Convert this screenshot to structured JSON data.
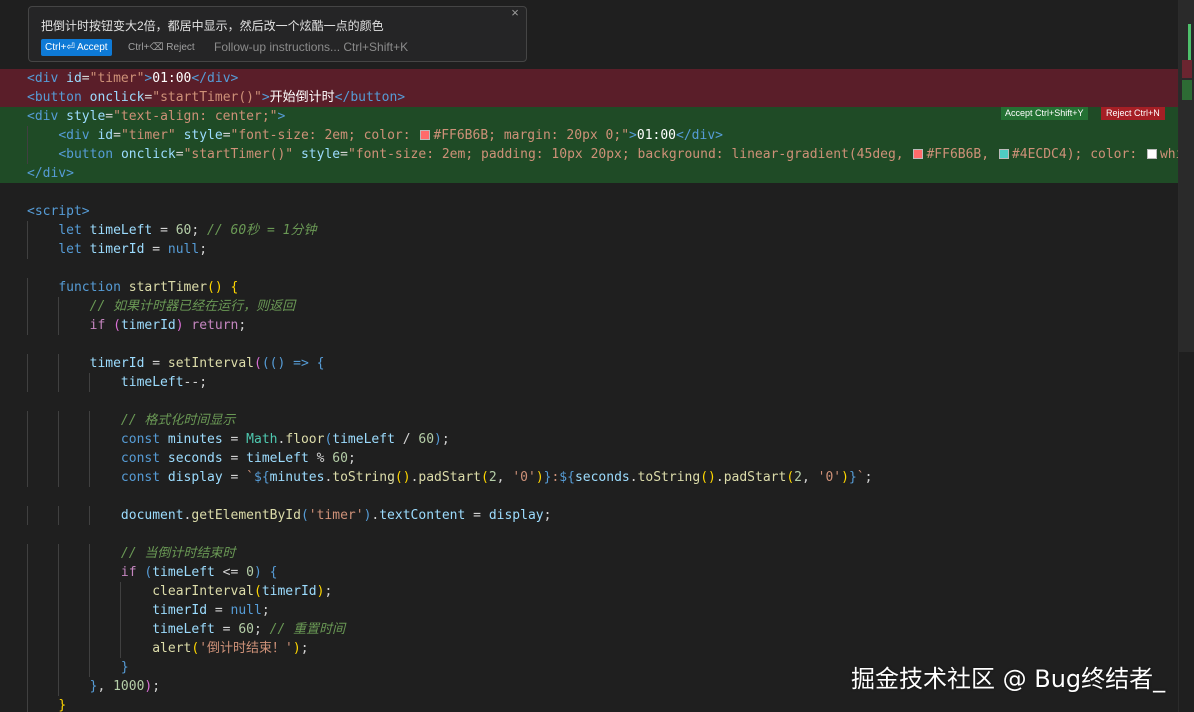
{
  "prompt": {
    "instruction": "把倒计时按钮变大2倍，都居中显示，然后改一个炫酷一点的颜色",
    "accept_label": "Ctrl+⏎ Accept",
    "reject_label": "Ctrl+⌫ Reject",
    "followup_placeholder": "Follow-up instructions... Ctrl+Shift+K",
    "close_icon": "×"
  },
  "diff_actions": {
    "accept_label": "Accept Ctrl+Shift+Y",
    "reject_label": "Reject Ctrl+N"
  },
  "colors": {
    "deleted_bg": "#5a1e29",
    "added_bg": "#1f4b26",
    "swatch_coral": "#FF6B6B",
    "swatch_teal": "#4ECDC4",
    "swatch_white": "#ffffff"
  },
  "code_lines": [
    {
      "kind": "del",
      "indent": 0,
      "tokens": [
        [
          "tag",
          "<div "
        ],
        [
          "attr",
          "id"
        ],
        [
          "op",
          "="
        ],
        [
          "str",
          "\"timer\""
        ],
        [
          "tag",
          ">"
        ],
        [
          "white",
          "01:00"
        ],
        [
          "tag",
          "</div>"
        ]
      ]
    },
    {
      "kind": "del",
      "indent": 0,
      "tokens": [
        [
          "tag",
          "<button "
        ],
        [
          "attr",
          "onclick"
        ],
        [
          "op",
          "="
        ],
        [
          "str",
          "\"startTimer()\""
        ],
        [
          "tag",
          ">"
        ],
        [
          "white",
          "开始倒计时"
        ],
        [
          "tag",
          "</button>"
        ]
      ]
    },
    {
      "kind": "add",
      "indent": 0,
      "tokens": [
        [
          "tag",
          "<div "
        ],
        [
          "attr",
          "style"
        ],
        [
          "op",
          "="
        ],
        [
          "str",
          "\"text-align: center;\""
        ],
        [
          "tag",
          ">"
        ]
      ]
    },
    {
      "kind": "add",
      "indent": 1,
      "tokens": [
        [
          "tag",
          "<div "
        ],
        [
          "attr",
          "id"
        ],
        [
          "op",
          "="
        ],
        [
          "str",
          "\"timer\""
        ],
        [
          "plain",
          " "
        ],
        [
          "attr",
          "style"
        ],
        [
          "op",
          "="
        ],
        [
          "str",
          "\"font-size: 2em; color: "
        ],
        [
          "swatch",
          "#FF6B6B"
        ],
        [
          "str",
          "#FF6B6B; margin: 20px 0;\""
        ],
        [
          "tag",
          ">"
        ],
        [
          "white",
          "01:00"
        ],
        [
          "tag",
          "</div>"
        ]
      ]
    },
    {
      "kind": "add",
      "indent": 1,
      "tokens": [
        [
          "tag",
          "<button "
        ],
        [
          "attr",
          "onclick"
        ],
        [
          "op",
          "="
        ],
        [
          "str",
          "\"startTimer()\""
        ],
        [
          "plain",
          " "
        ],
        [
          "attr",
          "style"
        ],
        [
          "op",
          "="
        ],
        [
          "str",
          "\"font-size: 2em; padding: 10px 20px; background: linear-gradient(45deg, "
        ],
        [
          "swatch",
          "#FF6B6B"
        ],
        [
          "str",
          "#FF6B6B, "
        ],
        [
          "swatch",
          "#4ECDC4"
        ],
        [
          "str",
          "#4ECDC4); color: "
        ],
        [
          "swatch",
          "#ffffff"
        ],
        [
          "str",
          "white;"
        ]
      ]
    },
    {
      "kind": "add",
      "indent": 0,
      "tokens": [
        [
          "tag",
          "</div>"
        ]
      ]
    },
    {
      "kind": "",
      "indent": 0,
      "tokens": []
    },
    {
      "kind": "",
      "indent": 0,
      "tokens": [
        [
          "tag",
          "<script>"
        ]
      ]
    },
    {
      "kind": "",
      "indent": 1,
      "tokens": [
        [
          "kw",
          "let "
        ],
        [
          "var",
          "timeLeft"
        ],
        [
          "op",
          " = "
        ],
        [
          "num",
          "60"
        ],
        [
          "op",
          "; "
        ],
        [
          "comment",
          "// 60秒 = 1分钟"
        ]
      ]
    },
    {
      "kind": "",
      "indent": 1,
      "tokens": [
        [
          "kw",
          "let "
        ],
        [
          "var",
          "timerId"
        ],
        [
          "op",
          " = "
        ],
        [
          "kw",
          "null"
        ],
        [
          "op",
          ";"
        ]
      ]
    },
    {
      "kind": "",
      "indent": 0,
      "tokens": []
    },
    {
      "kind": "",
      "indent": 1,
      "tokens": [
        [
          "kw",
          "function "
        ],
        [
          "fn",
          "startTimer"
        ],
        [
          "brace",
          "()"
        ],
        [
          "plain",
          " "
        ],
        [
          "brace",
          "{"
        ]
      ]
    },
    {
      "kind": "",
      "indent": 2,
      "tokens": [
        [
          "comment",
          "// 如果计时器已经在运行，则返回"
        ]
      ]
    },
    {
      "kind": "",
      "indent": 2,
      "tokens": [
        [
          "ctrl",
          "if "
        ],
        [
          "paren",
          "("
        ],
        [
          "var",
          "timerId"
        ],
        [
          "paren",
          ")"
        ],
        [
          "plain",
          " "
        ],
        [
          "ctrl",
          "return"
        ],
        [
          "op",
          ";"
        ]
      ]
    },
    {
      "kind": "",
      "indent": 0,
      "tokens": []
    },
    {
      "kind": "",
      "indent": 2,
      "tokens": [
        [
          "var",
          "timerId"
        ],
        [
          "op",
          " = "
        ],
        [
          "fn",
          "setInterval"
        ],
        [
          "paren",
          "("
        ],
        [
          "tag",
          "(() => {"
        ]
      ]
    },
    {
      "kind": "",
      "indent": 3,
      "tokens": [
        [
          "var",
          "timeLeft"
        ],
        [
          "op",
          "--;"
        ]
      ]
    },
    {
      "kind": "",
      "indent": 0,
      "tokens": []
    },
    {
      "kind": "",
      "indent": 3,
      "tokens": [
        [
          "comment",
          "// 格式化时间显示"
        ]
      ]
    },
    {
      "kind": "",
      "indent": 3,
      "tokens": [
        [
          "kw",
          "const "
        ],
        [
          "var",
          "minutes"
        ],
        [
          "op",
          " = "
        ],
        [
          "cyan",
          "Math"
        ],
        [
          "op",
          "."
        ],
        [
          "fn",
          "floor"
        ],
        [
          "tag",
          "("
        ],
        [
          "var",
          "timeLeft"
        ],
        [
          "op",
          " / "
        ],
        [
          "num",
          "60"
        ],
        [
          "tag",
          ")"
        ],
        [
          "op",
          ";"
        ]
      ]
    },
    {
      "kind": "",
      "indent": 3,
      "tokens": [
        [
          "kw",
          "const "
        ],
        [
          "var",
          "seconds"
        ],
        [
          "op",
          " = "
        ],
        [
          "var",
          "timeLeft"
        ],
        [
          "op",
          " % "
        ],
        [
          "num",
          "60"
        ],
        [
          "op",
          ";"
        ]
      ]
    },
    {
      "kind": "",
      "indent": 3,
      "tokens": [
        [
          "kw",
          "const "
        ],
        [
          "var",
          "display"
        ],
        [
          "op",
          " = "
        ],
        [
          "str",
          "`"
        ],
        [
          "kw",
          "${"
        ],
        [
          "var",
          "minutes"
        ],
        [
          "op",
          "."
        ],
        [
          "fn",
          "toString"
        ],
        [
          "brace",
          "()"
        ],
        [
          "op",
          "."
        ],
        [
          "fn",
          "padStart"
        ],
        [
          "brace",
          "("
        ],
        [
          "num",
          "2"
        ],
        [
          "op",
          ", "
        ],
        [
          "str",
          "'0'"
        ],
        [
          "brace",
          ")"
        ],
        [
          "kw",
          "}"
        ],
        [
          "str",
          ":"
        ],
        [
          "kw",
          "${"
        ],
        [
          "var",
          "seconds"
        ],
        [
          "op",
          "."
        ],
        [
          "fn",
          "toString"
        ],
        [
          "brace",
          "()"
        ],
        [
          "op",
          "."
        ],
        [
          "fn",
          "padStart"
        ],
        [
          "brace",
          "("
        ],
        [
          "num",
          "2"
        ],
        [
          "op",
          ", "
        ],
        [
          "str",
          "'0'"
        ],
        [
          "brace",
          ")"
        ],
        [
          "kw",
          "}"
        ],
        [
          "str",
          "`"
        ],
        [
          "op",
          ";"
        ]
      ]
    },
    {
      "kind": "",
      "indent": 0,
      "tokens": []
    },
    {
      "kind": "",
      "indent": 3,
      "tokens": [
        [
          "var",
          "document"
        ],
        [
          "op",
          "."
        ],
        [
          "fn",
          "getElementById"
        ],
        [
          "tag",
          "("
        ],
        [
          "str",
          "'timer'"
        ],
        [
          "tag",
          ")"
        ],
        [
          "op",
          "."
        ],
        [
          "var",
          "textContent"
        ],
        [
          "op",
          " = "
        ],
        [
          "var",
          "display"
        ],
        [
          "op",
          ";"
        ]
      ]
    },
    {
      "kind": "",
      "indent": 0,
      "tokens": []
    },
    {
      "kind": "",
      "indent": 3,
      "tokens": [
        [
          "comment",
          "// 当倒计时结束时"
        ]
      ]
    },
    {
      "kind": "",
      "indent": 3,
      "tokens": [
        [
          "ctrl",
          "if "
        ],
        [
          "tag",
          "("
        ],
        [
          "var",
          "timeLeft"
        ],
        [
          "op",
          " <= "
        ],
        [
          "num",
          "0"
        ],
        [
          "tag",
          ")"
        ],
        [
          "plain",
          " "
        ],
        [
          "tag",
          "{"
        ]
      ]
    },
    {
      "kind": "",
      "indent": 4,
      "tokens": [
        [
          "fn",
          "clearInterval"
        ],
        [
          "brace",
          "("
        ],
        [
          "var",
          "timerId"
        ],
        [
          "brace",
          ")"
        ],
        [
          "op",
          ";"
        ]
      ]
    },
    {
      "kind": "",
      "indent": 4,
      "tokens": [
        [
          "var",
          "timerId"
        ],
        [
          "op",
          " = "
        ],
        [
          "kw",
          "null"
        ],
        [
          "op",
          ";"
        ]
      ]
    },
    {
      "kind": "",
      "indent": 4,
      "tokens": [
        [
          "var",
          "timeLeft"
        ],
        [
          "op",
          " = "
        ],
        [
          "num",
          "60"
        ],
        [
          "op",
          "; "
        ],
        [
          "comment",
          "// 重置时间"
        ]
      ]
    },
    {
      "kind": "",
      "indent": 4,
      "tokens": [
        [
          "fn",
          "alert"
        ],
        [
          "brace",
          "("
        ],
        [
          "str",
          "'倒计时结束！'"
        ],
        [
          "brace",
          ")"
        ],
        [
          "op",
          ";"
        ]
      ]
    },
    {
      "kind": "",
      "indent": 3,
      "tokens": [
        [
          "tag",
          "}"
        ]
      ]
    },
    {
      "kind": "",
      "indent": 2,
      "tokens": [
        [
          "tag",
          "}"
        ],
        [
          "op",
          ", "
        ],
        [
          "num",
          "1000"
        ],
        [
          "paren",
          ")"
        ],
        [
          "op",
          ";"
        ]
      ]
    },
    {
      "kind": "",
      "indent": 1,
      "tokens": [
        [
          "brace",
          "}"
        ]
      ]
    }
  ],
  "watermark": "掘金技术社区 @ Bug终结者_"
}
